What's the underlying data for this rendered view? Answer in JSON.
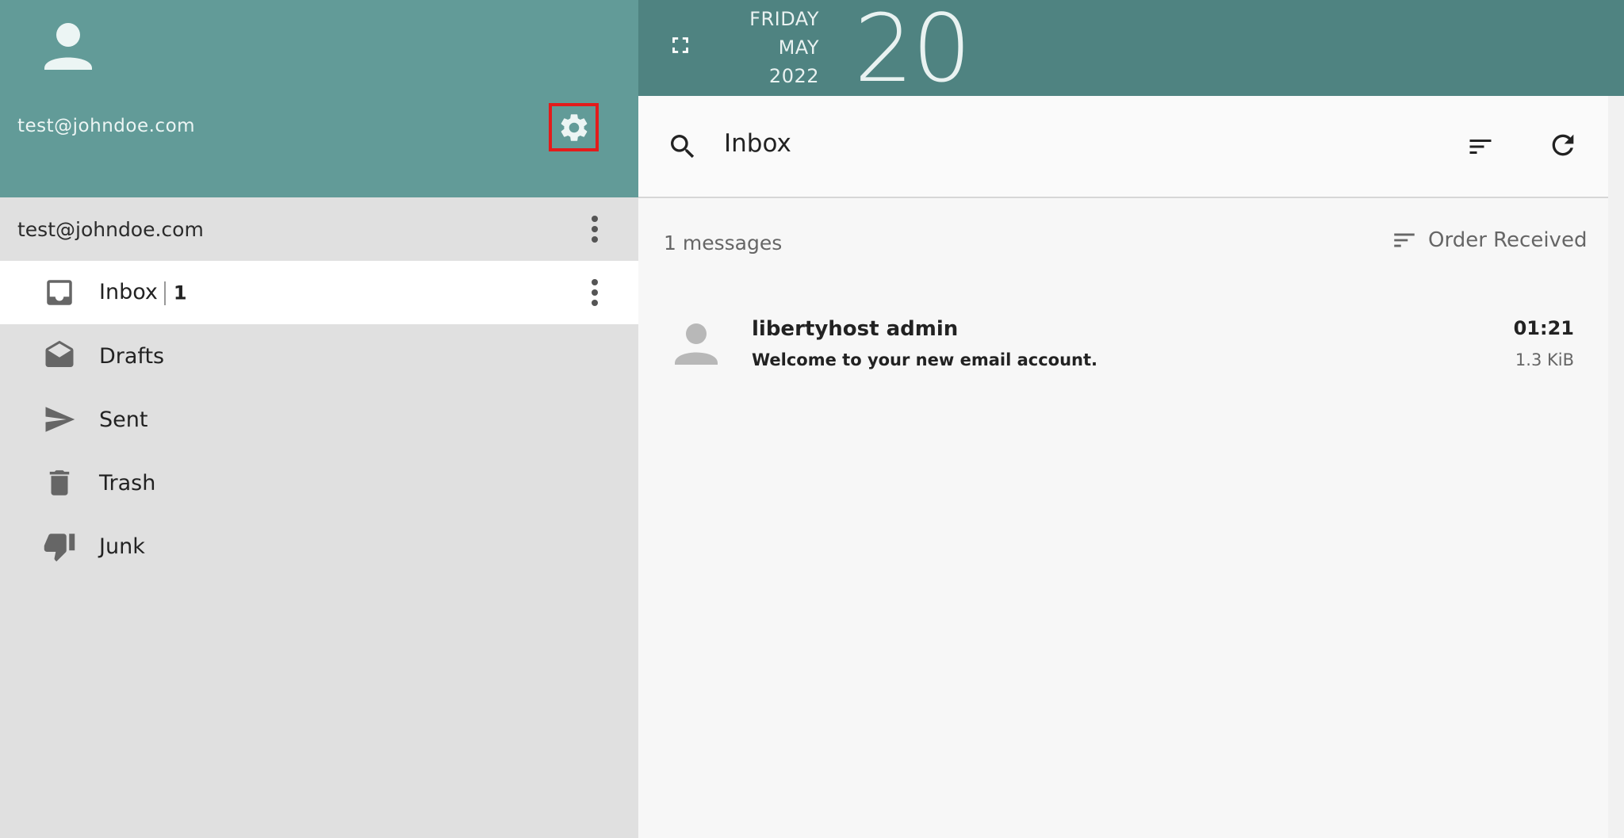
{
  "sidebar": {
    "header_email": "test@johndoe.com",
    "account_label": "test@johndoe.com",
    "folders": [
      {
        "label": "Inbox",
        "count": "1"
      },
      {
        "label": "Drafts"
      },
      {
        "label": "Sent"
      },
      {
        "label": "Trash"
      },
      {
        "label": "Junk"
      }
    ]
  },
  "topbar": {
    "weekday": "FRIDAY",
    "month": "MAY",
    "year": "2022",
    "day": "20"
  },
  "mailbox": {
    "title": "Inbox",
    "message_count": "1 messages",
    "order_label": "Order Received",
    "messages": [
      {
        "from": "libertyhost admin",
        "subject": "Welcome to your new email account.",
        "time": "01:21",
        "size": "1.3 KiB"
      }
    ]
  },
  "colors": {
    "sidebar_header": "#629b98",
    "topbar": "#4f8381",
    "highlight_border": "#e31b1b"
  },
  "icons": [
    "user-icon",
    "gear-icon",
    "kebab-menu-icon",
    "inbox-icon",
    "drafts-icon",
    "send-icon",
    "trash-icon",
    "thumbs-down-icon",
    "fullscreen-icon",
    "search-icon",
    "filter-icon",
    "refresh-icon",
    "sort-icon"
  ]
}
